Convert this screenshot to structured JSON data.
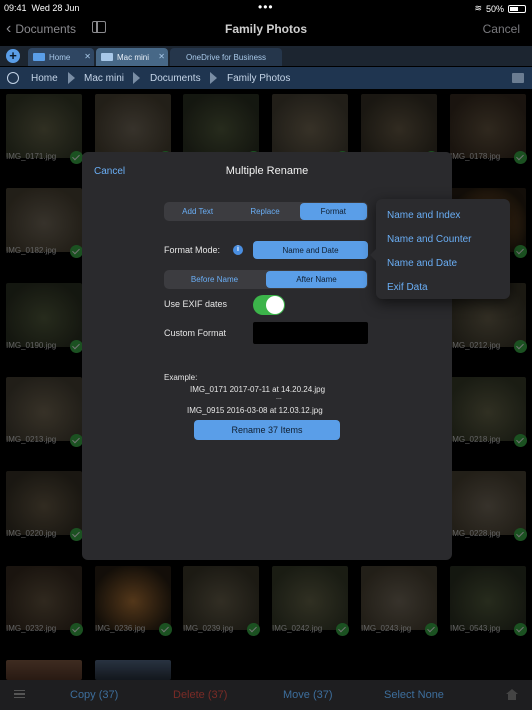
{
  "status": {
    "time": "09:41",
    "date": "Wed 28 Jun",
    "battery": "50%"
  },
  "nav": {
    "back_label": "Documents",
    "title": "Family Photos",
    "cancel_label": "Cancel"
  },
  "tabs": [
    {
      "label": "Home"
    },
    {
      "label": "Mac mini"
    },
    {
      "label": "OneDrive for Business"
    }
  ],
  "breadcrumbs": [
    "Home",
    "Mac mini",
    "Documents",
    "Family Photos"
  ],
  "files": [
    "IMG_0171.jpg",
    "",
    "",
    "",
    "",
    "IMG_0178.jpg",
    "IMG_0182.jpg",
    "",
    "",
    "",
    "",
    "",
    "IMG_0190.jpg",
    "",
    "",
    "",
    "",
    "IMG_0212.jpg",
    "IMG_0213.jpg",
    "",
    "",
    "",
    "",
    "IMG_0218.jpg",
    "IMG_0220.jpg",
    "",
    "",
    "",
    "",
    "IMG_0228.jpg",
    "IMG_0232.jpg",
    "IMG_0236.jpg",
    "IMG_0239.jpg",
    "IMG_0242.jpg",
    "IMG_0243.jpg",
    "IMG_0543.jpg"
  ],
  "dialog": {
    "cancel_label": "Cancel",
    "title": "Multiple Rename",
    "tabs": [
      "Add Text",
      "Replace",
      "Format"
    ],
    "format_mode_label": "Format Mode:",
    "format_mode_value": "Name and Date",
    "position": [
      "Before Name",
      "After Name"
    ],
    "exif_label": "Use EXIF dates",
    "exif_enabled": true,
    "custom_format_label": "Custom Format",
    "custom_format_value": "",
    "example_label": "Example:",
    "example_first": "IMG_0171 2017-07-11 at 14.20.24.jpg",
    "example_ellipsis": "...",
    "example_last": "IMG_0915 2016-03-08 at 12.03.12.jpg",
    "rename_button": "Rename 37 Items"
  },
  "popover": [
    "Name and Index",
    "Name and Counter",
    "Name and Date",
    "Exif Data"
  ],
  "toolbar": {
    "copy": "Copy (37)",
    "delete": "Delete (37)",
    "move": "Move (37)",
    "select_none": "Select None"
  },
  "colors": {
    "accent": "#5a9ee8",
    "check": "#3cb44a",
    "delete": "#c0392b"
  }
}
